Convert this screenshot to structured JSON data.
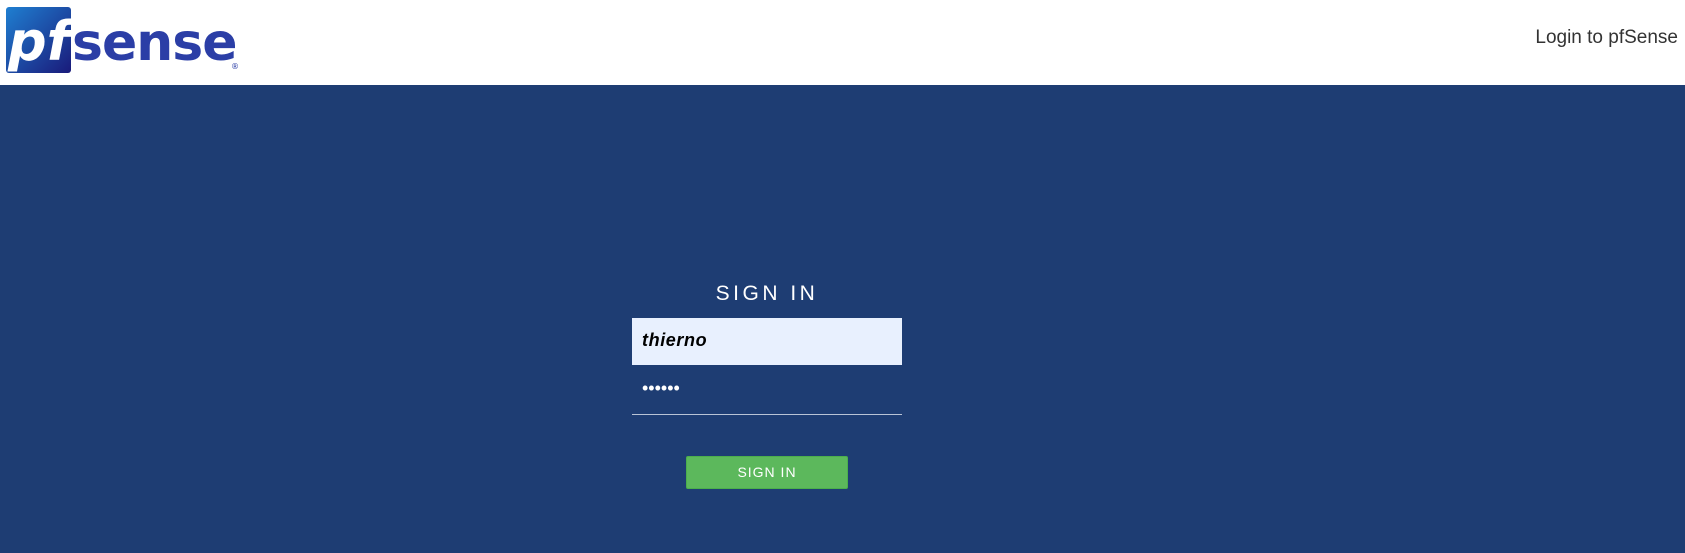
{
  "header": {
    "logo_text_pf": "pf",
    "logo_text_sense": "sense",
    "logo_registered": "®",
    "title": "Login to pfSense"
  },
  "login": {
    "heading": "SIGN IN",
    "username_value": "thierno",
    "password_masked": "••••••",
    "submit_label": "SIGN IN"
  },
  "colors": {
    "background": "#1e3d73",
    "header_bg": "#ffffff",
    "logo_square": "#1f77c9",
    "logo_text": "#2b3ea6",
    "button": "#5cb85c",
    "username_field_bg": "#e8f0fe"
  }
}
